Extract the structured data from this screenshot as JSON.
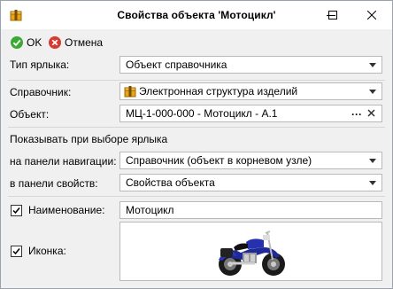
{
  "window": {
    "title": "Свойства объекта 'Мотоцикл'",
    "icon": "package-icon"
  },
  "toolbar": {
    "ok_label": "OK",
    "cancel_label": "Отмена"
  },
  "form": {
    "label_type": {
      "label": "Тип ярлыка:",
      "value": "Объект справочника"
    },
    "directory": {
      "label": "Справочник:",
      "value": "Электронная структура изделий"
    },
    "object": {
      "label": "Объект:",
      "value": "МЦ-1-000-000 - Мотоцикл - А.1",
      "dots": "···"
    },
    "show_section": "Показывать при выборе ярлыка",
    "nav_panel": {
      "label": "на панели навигации:",
      "value": "Справочник (объект в корневом узле)"
    },
    "props_panel": {
      "label": "в панели свойств:",
      "value": "Свойства объекта"
    },
    "name": {
      "label": "Наименование:",
      "value": "Мотоцикл",
      "checked": true
    },
    "icon": {
      "label": "Иконка:",
      "checked": true,
      "image": "motorcycle-image"
    }
  },
  "colors": {
    "ok": "#3aaa35",
    "cancel": "#d9382e",
    "accent": "#e8a418"
  }
}
